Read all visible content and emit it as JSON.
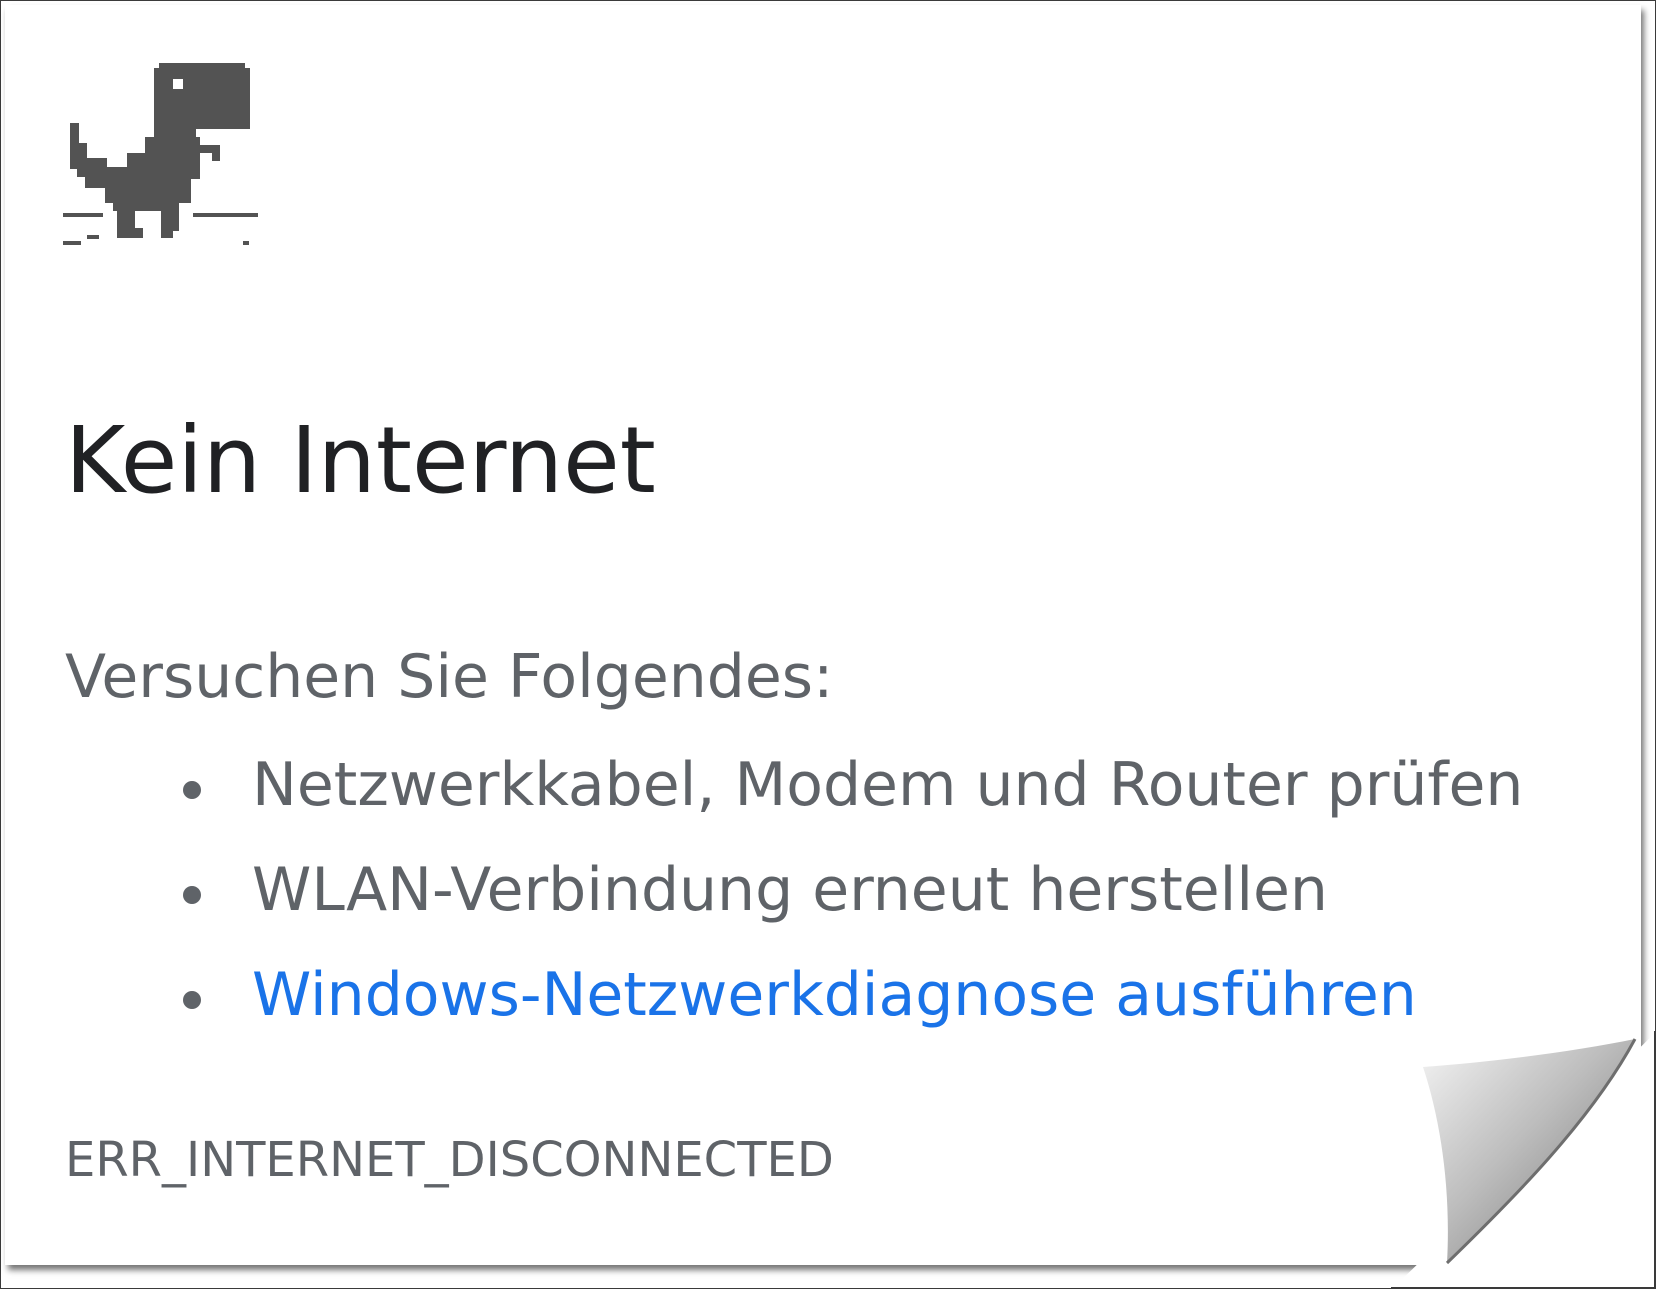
{
  "error_page": {
    "icon": "offline-dinosaur-icon",
    "title": "Kein Internet",
    "suggestions_heading": "Versuchen Sie Folgendes:",
    "suggestions": [
      {
        "label": "Netzwerkkabel, Modem und Router prüfen",
        "is_link": false
      },
      {
        "label": "WLAN-Verbindung erneut herstellen",
        "is_link": false
      },
      {
        "label": "Windows-Netzwerkdiagnose ausführen",
        "is_link": true
      }
    ],
    "error_code": "ERR_INTERNET_DISCONNECTED"
  },
  "colors": {
    "title": "#202124",
    "body_text": "#5f6368",
    "link": "#1a73e8",
    "dino": "#535353"
  }
}
